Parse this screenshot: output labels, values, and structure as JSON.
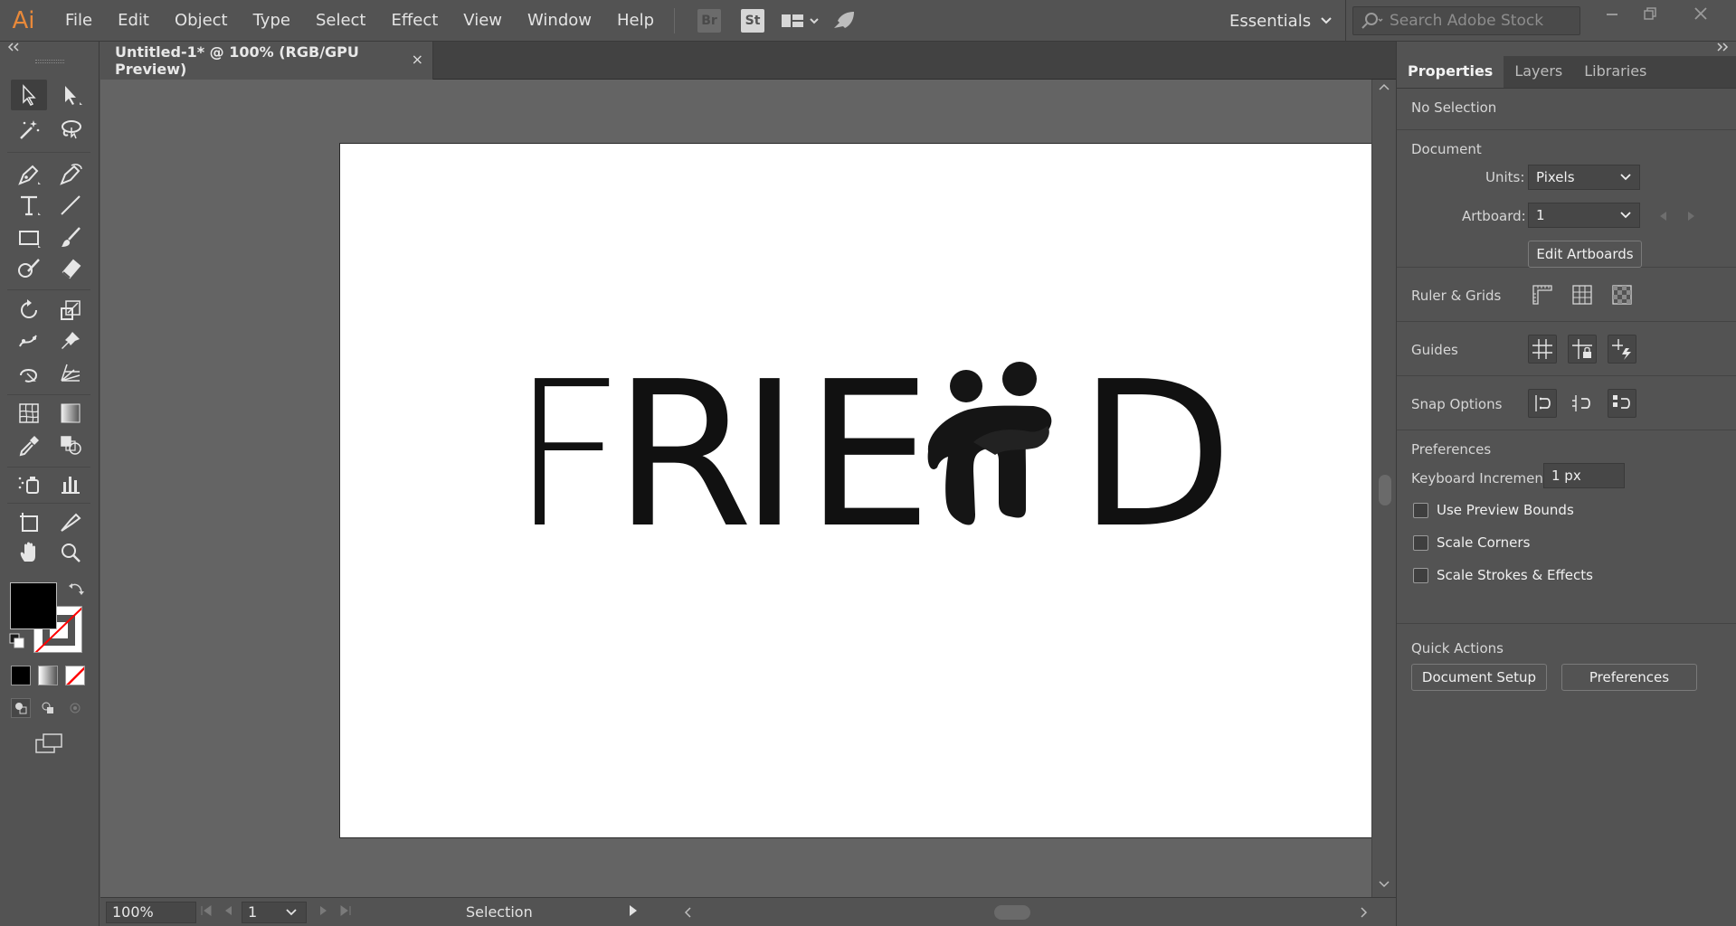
{
  "app": {
    "logo": "Ai"
  },
  "menu": [
    "File",
    "Edit",
    "Object",
    "Type",
    "Select",
    "Effect",
    "View",
    "Window",
    "Help"
  ],
  "menubar": {
    "bridge_badge": "Br",
    "stock_badge": "St",
    "workspace": "Essentials",
    "search_placeholder": "Search Adobe Stock"
  },
  "document": {
    "tab_title": "Untitled-1* @ 100% (RGB/GPU Preview)",
    "close_glyph": "×"
  },
  "artwork": {
    "letters": [
      "F",
      "R",
      "I",
      "E",
      "D"
    ],
    "word": "FRIE D"
  },
  "statusbar": {
    "zoom": "100%",
    "artboard_number": "1",
    "current_tool": "Selection"
  },
  "properties_panel": {
    "tabs": [
      "Properties",
      "Layers",
      "Libraries"
    ],
    "active_tab": "Properties",
    "selection_state": "No Selection",
    "document_heading": "Document",
    "units_label": "Units:",
    "units_value": "Pixels",
    "artboard_label": "Artboard:",
    "artboard_value": "1",
    "edit_artboards_button": "Edit Artboards",
    "ruler_grids_label": "Ruler & Grids",
    "guides_label": "Guides",
    "snap_options_label": "Snap Options",
    "preferences_heading": "Preferences",
    "keyboard_increment_label": "Keyboard Increment:",
    "keyboard_increment_value": "1 px",
    "checkboxes": [
      {
        "label": "Use Preview Bounds",
        "checked": false
      },
      {
        "label": "Scale Corners",
        "checked": false
      },
      {
        "label": "Scale Strokes & Effects",
        "checked": false
      }
    ],
    "quick_actions_heading": "Quick Actions",
    "document_setup_button": "Document Setup",
    "preferences_button": "Preferences"
  },
  "colors": {
    "ui_bg": "#535353",
    "canvas_bg": "#646464",
    "artboard_bg": "#ffffff",
    "logo_orange": "#e8893a",
    "fill_swatch": "#000000",
    "stroke_none": "#ff0000"
  }
}
